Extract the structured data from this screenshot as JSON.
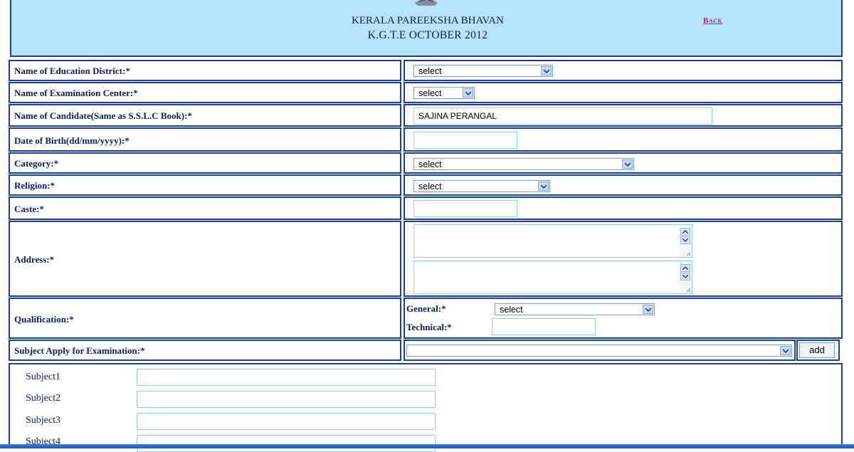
{
  "header": {
    "title_line1": "KERALA PAREEKSHA BHAVAN",
    "title_line2": "K.G.T.E OCTOBER 2012",
    "back_link": "Back"
  },
  "form": {
    "education_district": {
      "label": "Name of Education District:*",
      "selected": "select"
    },
    "exam_center": {
      "label": "Name of Examination Center:*",
      "selected": "select"
    },
    "candidate_name": {
      "label": "Name of Candidate(Same as S.S.L.C Book):*",
      "value": "SAJINA PERANGAL"
    },
    "dob": {
      "label": "Date of Birth(dd/mm/yyyy):*",
      "value": ""
    },
    "category": {
      "label": "Category:*",
      "selected": "select"
    },
    "religion": {
      "label": "Religion:*",
      "selected": "select"
    },
    "caste": {
      "label": "Caste:*",
      "value": ""
    },
    "address": {
      "label": "Address:*",
      "line1": "",
      "line2": ""
    },
    "qualification": {
      "label": "Qualification:*",
      "general_label": "General:*",
      "general_selected": "select",
      "technical_label": "Technical:*",
      "technical_value": ""
    },
    "subject_apply": {
      "label": "Subject Apply for Examination:*",
      "selected": "",
      "add_label": "add"
    }
  },
  "subjects": [
    {
      "label": "Subject1",
      "value": ""
    },
    {
      "label": "Subject2",
      "value": ""
    },
    {
      "label": "Subject3",
      "value": ""
    },
    {
      "label": "Subject4",
      "value": ""
    }
  ],
  "colors": {
    "header_bg": "#b7e3fb",
    "border": "#1c3f8f",
    "label_text": "#0a1e60",
    "back_link": "#c2186f",
    "input_border": "#8fd3ee"
  }
}
